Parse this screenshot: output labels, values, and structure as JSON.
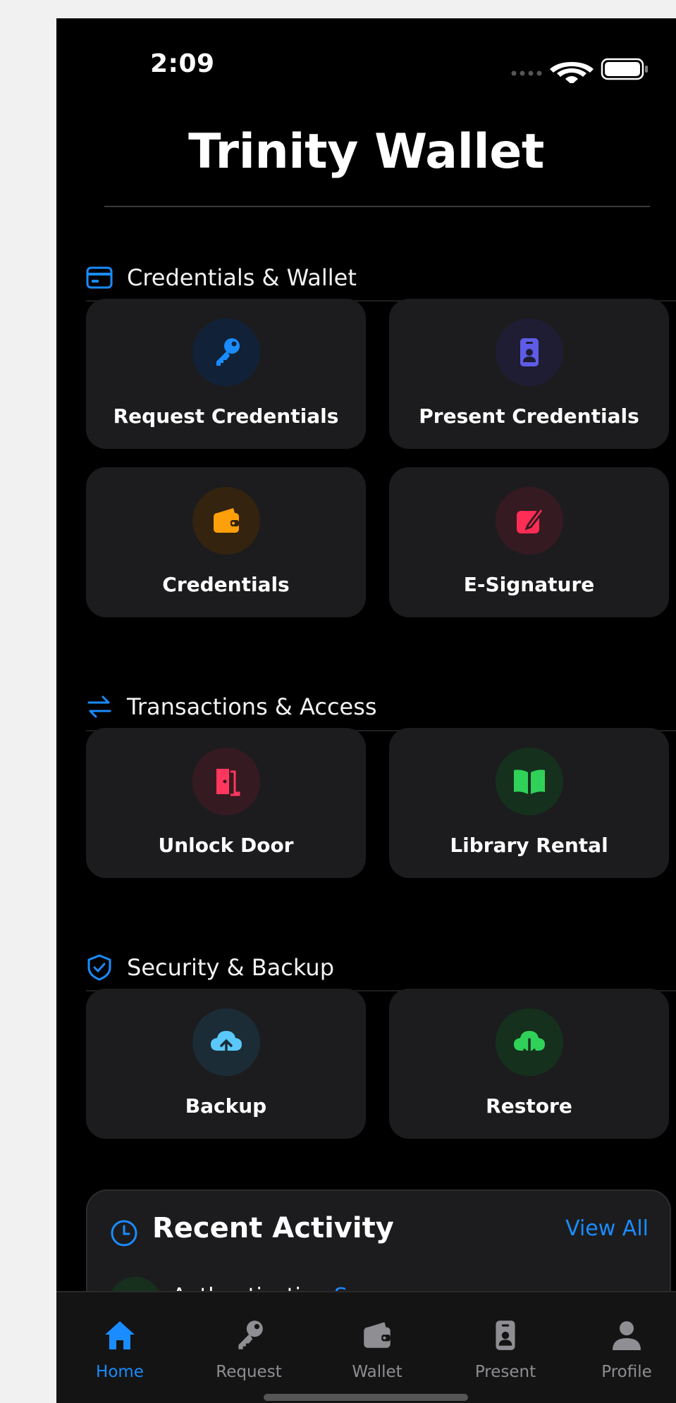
{
  "status_bar": {
    "time": "2:09"
  },
  "app": {
    "title": "Trinity Wallet"
  },
  "sections": [
    {
      "title": "Credentials & Wallet",
      "icon": "card-icon",
      "cards": [
        {
          "label": "Request Credentials",
          "icon": "key-icon",
          "color": "#1a8cff",
          "bg": "#112238"
        },
        {
          "label": "Present Credentials",
          "icon": "id-badge-icon",
          "color": "#5e5ce6",
          "bg": "#1e1d33"
        },
        {
          "label": "Credentials",
          "icon": "wallet-icon",
          "color": "#ff9f0a",
          "bg": "#33230f"
        },
        {
          "label": "E-Signature",
          "icon": "signature-icon",
          "color": "#ff2d55",
          "bg": "#361a21"
        }
      ]
    },
    {
      "title": "Transactions & Access",
      "icon": "arrows-swap-icon",
      "cards": [
        {
          "label": "Unlock Door",
          "icon": "door-icon",
          "color": "#ff375f",
          "bg": "#361a21"
        },
        {
          "label": "Library Rental",
          "icon": "book-icon",
          "color": "#30d158",
          "bg": "#15301d"
        }
      ]
    },
    {
      "title": "Security & Backup",
      "icon": "shield-check-icon",
      "cards": [
        {
          "label": "Backup",
          "icon": "cloud-upload-icon",
          "color": "#5ac8fa",
          "bg": "#1b2c36"
        },
        {
          "label": "Restore",
          "icon": "cloud-download-icon",
          "color": "#30d158",
          "bg": "#15301d"
        }
      ]
    }
  ],
  "recent_activity": {
    "title": "Recent Activity",
    "view_all": "View All",
    "first_item_title": "Authentication",
    "first_item_status": "Succ"
  },
  "tabs": [
    {
      "label": "Home",
      "icon": "home-icon",
      "active": true
    },
    {
      "label": "Request",
      "icon": "key-icon",
      "active": false
    },
    {
      "label": "Wallet",
      "icon": "wallet-icon",
      "active": false
    },
    {
      "label": "Present",
      "icon": "id-badge-icon",
      "active": false
    },
    {
      "label": "Profile",
      "icon": "person-icon",
      "active": false
    }
  ]
}
